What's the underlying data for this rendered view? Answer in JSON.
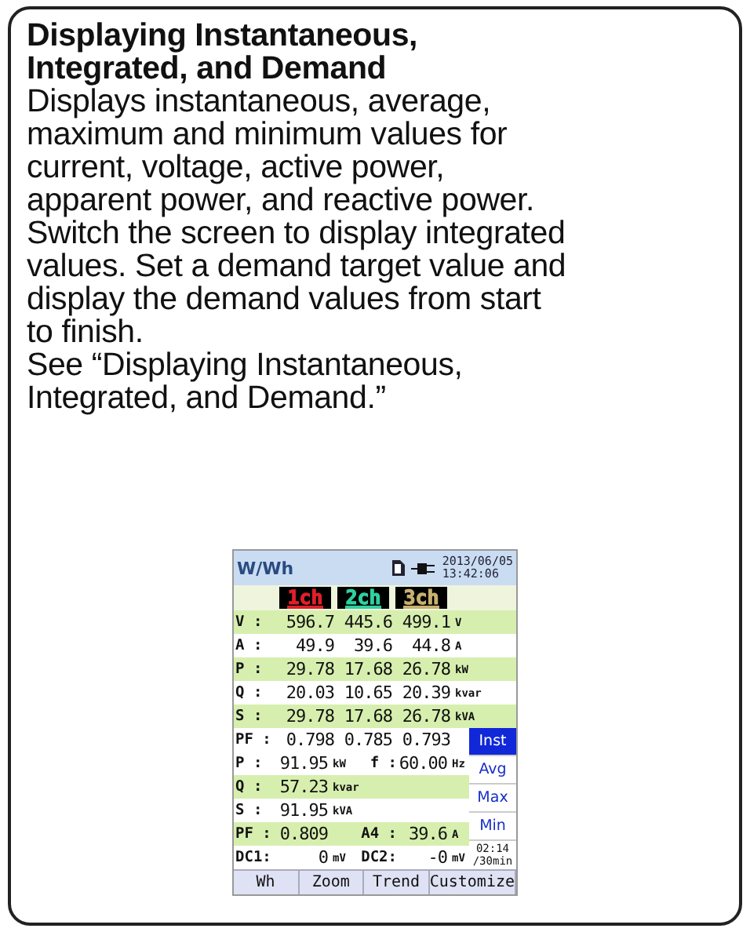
{
  "heading": "Displaying Instantaneous, Integrated, and Demand",
  "body": "Displays instantaneous, average, maximum and minimum values for current, voltage, active power, apparent power, and reactive power. Switch the screen to display integrated values. Set a demand target value and display the demand values from start to finish.",
  "reference": "See “Displaying Instantaneous, Integrated, and Demand.”",
  "device": {
    "title": "W/Wh",
    "date": "2013/06/05",
    "time": "13:42:06",
    "channels": [
      {
        "label": "1ch",
        "color": "#e0202a"
      },
      {
        "label": "2ch",
        "color": "#30d0a0"
      },
      {
        "label": "3ch",
        "color": "#c8b070"
      }
    ],
    "rows": [
      {
        "label": "V :",
        "values": [
          "596.7",
          "445.6",
          "499.1"
        ],
        "unit": "V"
      },
      {
        "label": "A :",
        "values": [
          "49.9",
          "39.6",
          "44.8"
        ],
        "unit": "A"
      },
      {
        "label": "P :",
        "values": [
          "29.78",
          "17.68",
          "26.78"
        ],
        "unit": "kW"
      },
      {
        "label": "Q :",
        "values": [
          "20.03",
          "10.65",
          "20.39"
        ],
        "unit": "kvar"
      },
      {
        "label": "S :",
        "values": [
          "29.78",
          "17.68",
          "26.78"
        ],
        "unit": "kVA"
      },
      {
        "label": "PF :",
        "values": [
          "0.798",
          "0.785",
          "0.793"
        ]
      }
    ],
    "totals": [
      {
        "label": "P :",
        "value": "91.95",
        "unit": "kW",
        "label2": "f :",
        "value2": "60.00",
        "unit2": "Hz"
      },
      {
        "label": "Q :",
        "value": "57.23",
        "unit": "kvar"
      },
      {
        "label": "S :",
        "value": "91.95",
        "unit": "kVA"
      },
      {
        "label": "PF :",
        "value": "0.809",
        "label2": "A4 :",
        "value2": "39.6",
        "unit2": "A"
      },
      {
        "label": "DC1:",
        "value": "0",
        "unit": "mV",
        "label2": "DC2:",
        "value2": "-0",
        "unit2": "mV"
      }
    ],
    "modes": [
      {
        "label": "Inst",
        "selected": true
      },
      {
        "label": "Avg",
        "selected": false
      },
      {
        "label": "Max",
        "selected": false
      },
      {
        "label": "Min",
        "selected": false
      }
    ],
    "elapsed": "02:14",
    "interval": "/30min",
    "softkeys": [
      "Wh",
      "Zoom",
      "Trend",
      "Customize"
    ]
  }
}
